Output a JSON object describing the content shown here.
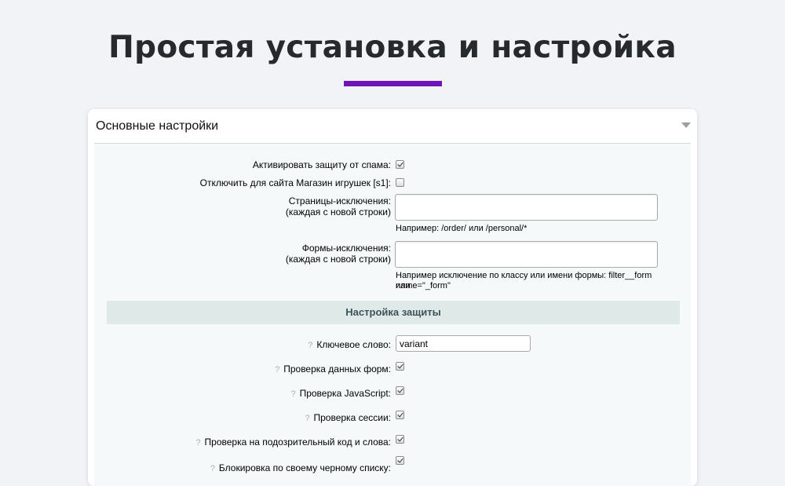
{
  "hero": {
    "title": "Простая установка и настройка"
  },
  "colors": {
    "accent": "#6e14b8",
    "section_bg": "#dfe9e8",
    "body_bg": "#f5f9f9"
  },
  "panel": {
    "title": "Основные настройки",
    "fields": {
      "activate": {
        "label": "Активировать защиту от спама:",
        "checked": true
      },
      "disable_site": {
        "label": "Отключить для сайта Магазин игрушек [s1]:",
        "checked": false
      },
      "pages_exclusions": {
        "label_line1": "Страницы-исключения:",
        "label_line2": "(каждая с новой строки)",
        "value": "",
        "note": "Например: /order/ или /personal/*"
      },
      "forms_exclusions": {
        "label_line1": "Формы-исключения:",
        "label_line2": "(каждая с новой строки)",
        "value": "",
        "note_line1": "Например исключение по классу или имени формы: filter__form или",
        "note_line2": "name=\"_form\""
      }
    },
    "protection": {
      "title": "Настройка защиты",
      "keyword": {
        "label": "Ключевое слово:",
        "value": "variant",
        "hint": "?"
      },
      "checks": [
        {
          "label": "Проверка данных форм:",
          "checked": true,
          "hint": "?"
        },
        {
          "label": "Проверка JavaScript:",
          "checked": true,
          "hint": "?"
        },
        {
          "label": "Проверка сессии:",
          "checked": true,
          "hint": "?"
        },
        {
          "label": "Проверка на подозрительный код и слова:",
          "checked": true,
          "hint": "?"
        },
        {
          "label": "Блокировка по своему черному списку:",
          "checked": true,
          "hint": "?"
        }
      ]
    }
  }
}
